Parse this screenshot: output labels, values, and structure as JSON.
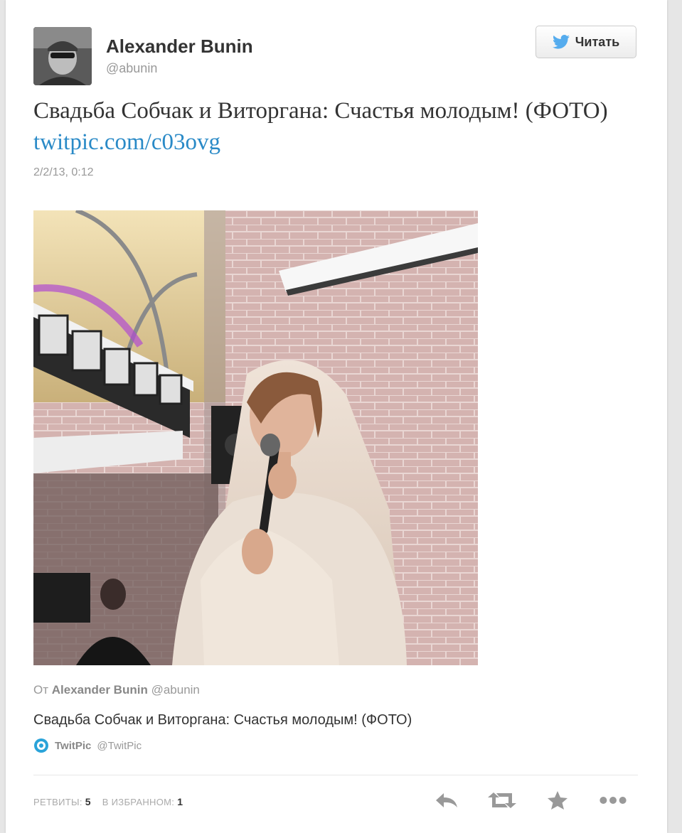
{
  "user": {
    "display_name": "Alexander Bunin",
    "handle": "@abunin"
  },
  "follow_button": {
    "label": "Читать"
  },
  "tweet": {
    "text": "Свадьба Собчак и Виторгана: Счастья молодым! (ФОТО)",
    "link": "twitpic.com/c03ovg",
    "timestamp": "2/2/13, 0:12"
  },
  "media_card": {
    "attribution_prefix": "От",
    "attribution_name": "Alexander Bunin",
    "attribution_handle": "@abunin",
    "title": "Свадьба Собчак и Виторгана: Счастья молодым! (ФОТО)",
    "source_name": "TwitPic",
    "source_handle": "@TwitPic"
  },
  "stats": {
    "retweets_label": "РЕТВИТЫ:",
    "retweets_count": "5",
    "favorites_label": "В ИЗБРАННОМ:",
    "favorites_count": "1"
  },
  "icons": {
    "follow": "twitter-bird-icon",
    "source": "twitpic-icon",
    "actions": [
      "reply-icon",
      "retweet-icon",
      "favorite-icon",
      "more-icon"
    ]
  },
  "colors": {
    "link": "#2a8ac7",
    "twitter_blue": "#55acee"
  }
}
